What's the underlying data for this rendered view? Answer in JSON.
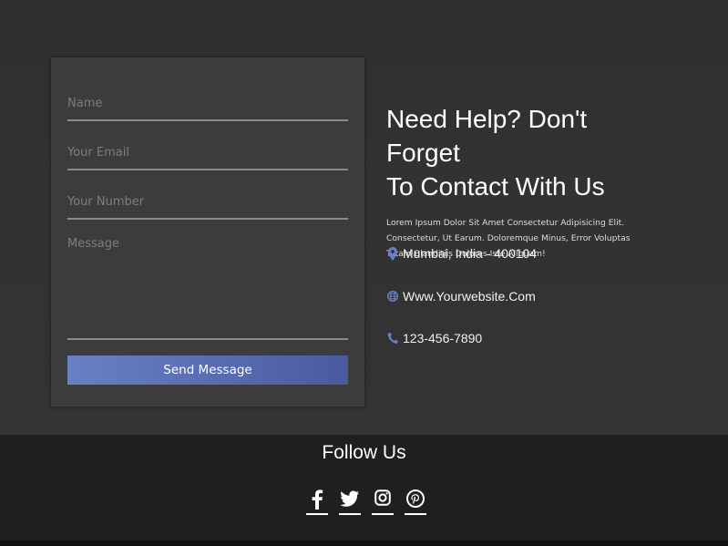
{
  "form": {
    "name_placeholder": "Name",
    "email_placeholder": "Your Email",
    "number_placeholder": "Your Number",
    "message_placeholder": "Message",
    "send_label": "Send Message"
  },
  "info": {
    "title_line1": "Need Help? Don't Forget",
    "title_line2": "To Contact With Us",
    "description": "Lorem Ipsum Dolor Sit Amet Consectetur Adipisicing Elit. Consectetur, Ut Earum. Doloremque Minus, Error Voluptas Totam Blanditiis Dolores Iste Aliquam!",
    "address": "Mumbai, India - 400104",
    "website": "Www.Yourwebsite.Com",
    "phone": "123-456-7890",
    "icons": {
      "address": "map-pin-icon",
      "website": "globe-icon",
      "phone": "phone-icon"
    }
  },
  "footer": {
    "follow_title": "Follow Us",
    "socials": [
      "facebook-icon",
      "twitter-icon",
      "instagram-icon",
      "pinterest-icon"
    ]
  },
  "colors": {
    "accent": "#5f73b9",
    "background": "#313131",
    "card": "#3c3c3c",
    "footer": "#1f1f1f"
  }
}
